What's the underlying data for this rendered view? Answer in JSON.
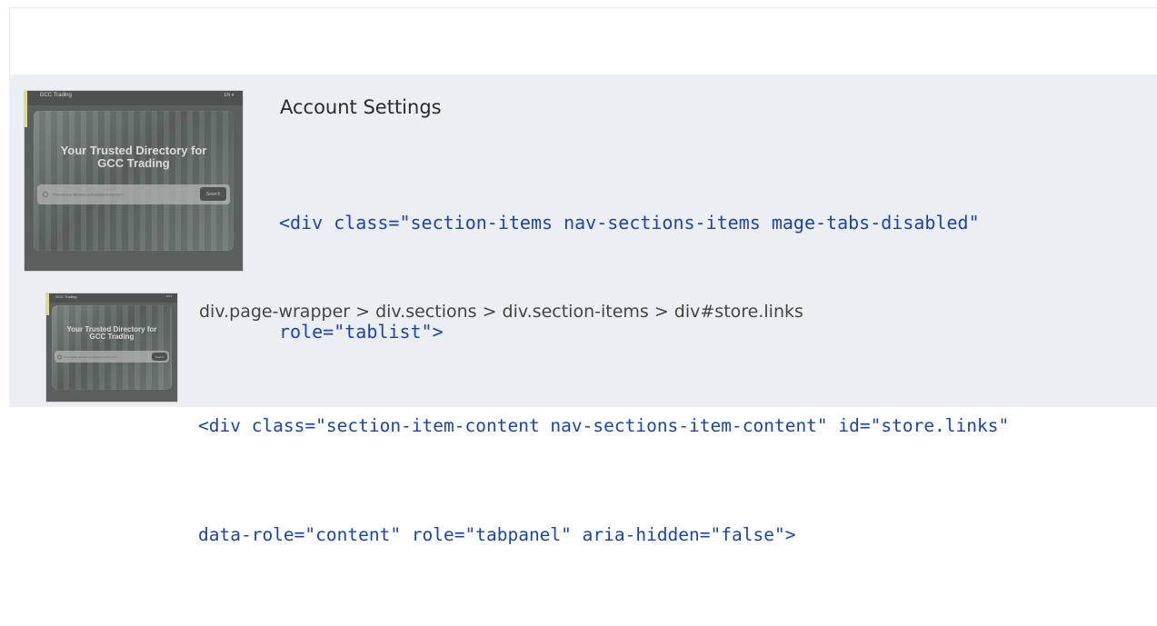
{
  "results": [
    {
      "title": "Account Settings",
      "code_lines": [
        "<div class=\"section-items nav-sections-items mage-tabs-disabled\"",
        "role=\"tablist\">"
      ],
      "thumbnail": {
        "brand": "GCC Trading",
        "topbar_right": "EN ▾",
        "headline_line1": "Your Trusted Directory for",
        "headline_line2": "GCC Trading",
        "search_placeholder": "Find Global Vendors & Products in the GCC",
        "search_button": "Search"
      }
    },
    {
      "title": "div.page-wrapper > div.sections > div.section-items > div#store.links",
      "code_lines": [
        "<div class=\"section-item-content nav-sections-item-content\" id=\"store.links\"",
        "data-role=\"content\" role=\"tabpanel\" aria-hidden=\"false\">"
      ],
      "thumbnail": {
        "brand": "GCC Trading",
        "topbar_right": "EN ▾",
        "headline_line1": "Your Trusted Directory for",
        "headline_line2": "GCC Trading",
        "search_placeholder": "Find Global Vendors & Products in the GCC",
        "search_button": "Search"
      }
    }
  ],
  "colors": {
    "code_text": "#1a44b6",
    "list_background": "#eceff2",
    "thumbnail_highlight": "#e4e74a"
  }
}
